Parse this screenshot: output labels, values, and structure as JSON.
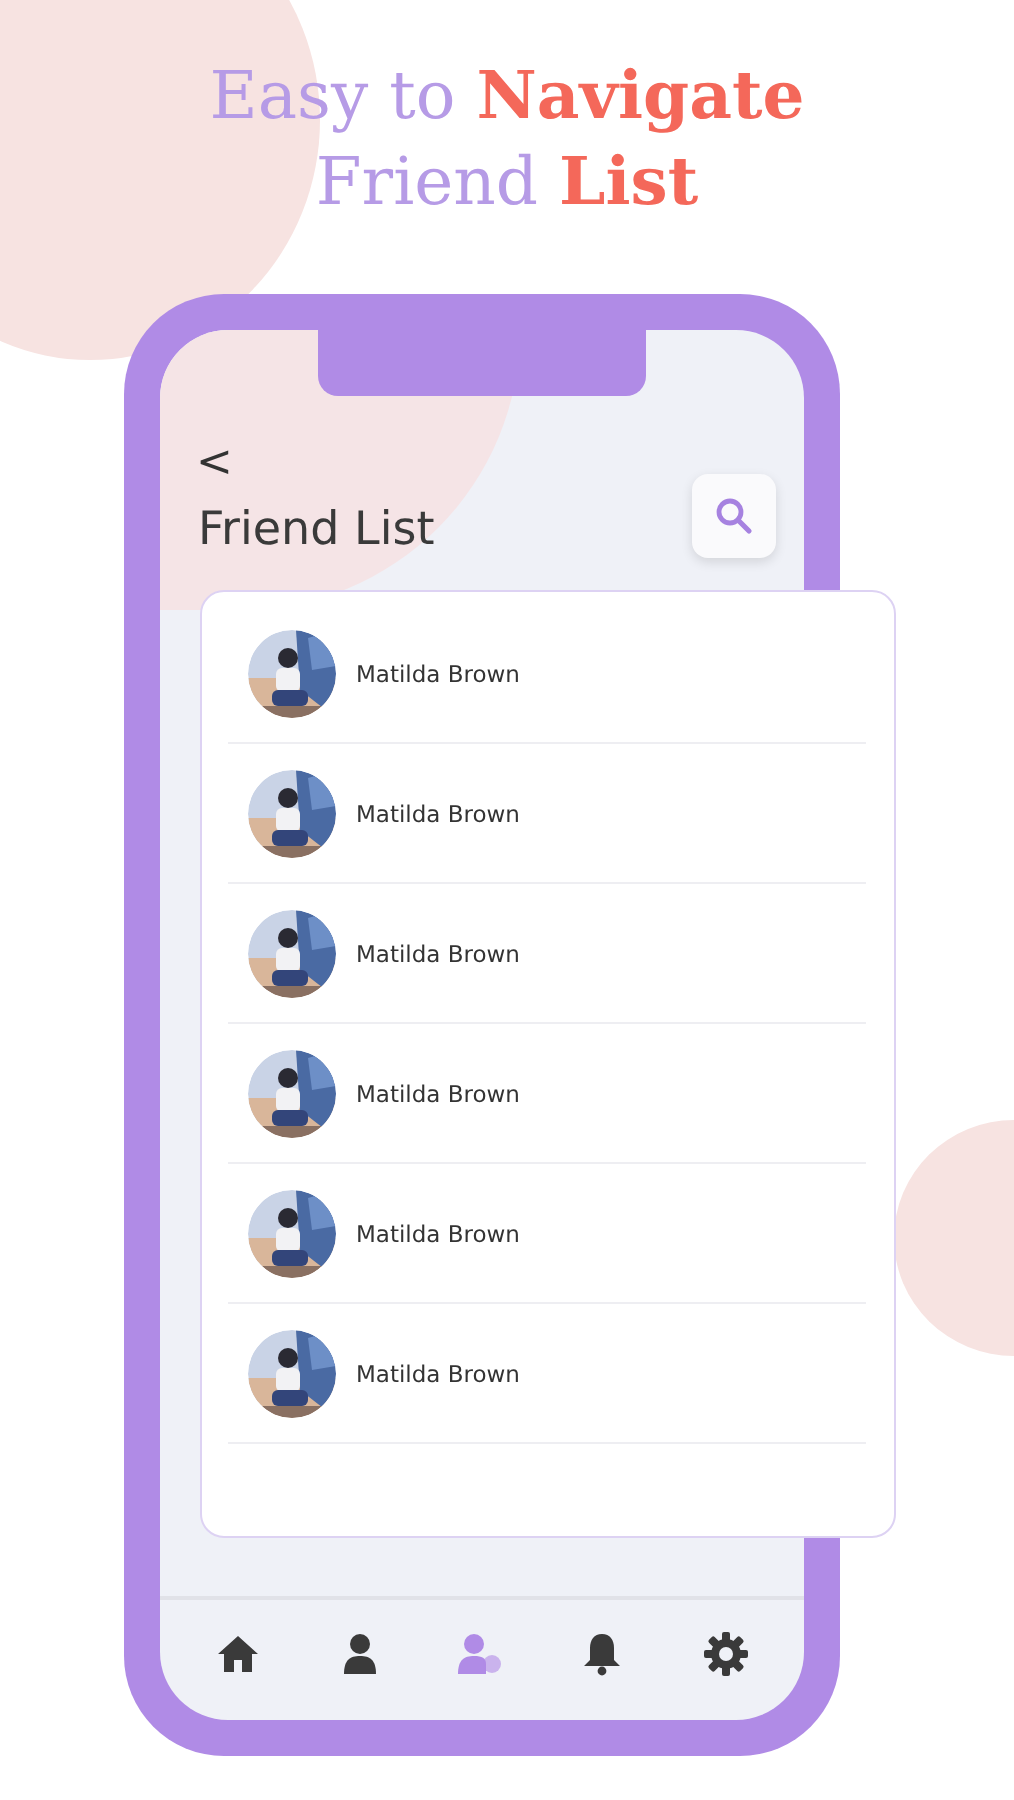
{
  "headline": [
    "Easy to **Navigate**",
    "Friend **List**"
  ],
  "screen": {
    "title": "Friend List",
    "back": "<"
  },
  "friends": [
    {
      "name": "Matilda Brown",
      "kind": "picture"
    },
    {
      "name": "Matilda Brown",
      "kind": "picture"
    },
    {
      "name": "Matilda Brown",
      "kind": "picture"
    },
    {
      "name": "Matilda Brown",
      "kind": "picture"
    },
    {
      "name": "Matilda Brown",
      "kind": "picture"
    },
    {
      "name": "Matilda Brown",
      "kind": "picture"
    }
  ],
  "nav": [
    {
      "kind": "home",
      "selected": false
    },
    {
      "kind": "person",
      "selected": false
    },
    {
      "kind": "friends",
      "selected": true
    },
    {
      "kind": "bell",
      "selected": false
    },
    {
      "kind": "gear",
      "selected": false
    }
  ]
}
